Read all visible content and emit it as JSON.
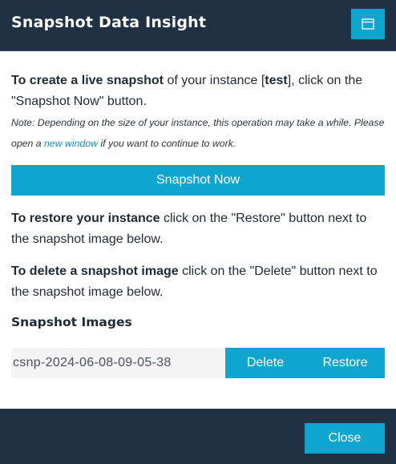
{
  "dialog": {
    "title": "Snapshot Data Insight",
    "header_icon": "window-icon"
  },
  "intro": {
    "bold": "To create a live snapshot",
    "text1": " of your instance [",
    "instance": "test",
    "text2": "], click on the \"Snapshot Now\" button."
  },
  "note": {
    "text1": "Note: Depending on the size of your instance, this operation may take a while. Please open a ",
    "link": "new window",
    "text2": " if you want to continue to work."
  },
  "snapshot_button": "Snapshot Now",
  "restore_info": {
    "bold": "To restore your instance",
    "text": " click on the \"Restore\" button next to the snapshot image below."
  },
  "delete_info": {
    "bold": "To delete a snapshot image",
    "text": " click on the \"Delete\" button next to the snapshot image below."
  },
  "images_section": {
    "title": "Snapshot Images",
    "items": [
      {
        "name": "csnp-2024-06-08-09-05-38",
        "delete_label": "Delete",
        "restore_label": "Restore"
      }
    ]
  },
  "footer": {
    "close_label": "Close"
  },
  "colors": {
    "header_bg": "#1f3143",
    "accent": "#0ea5cf",
    "link": "#1a8fb6"
  }
}
